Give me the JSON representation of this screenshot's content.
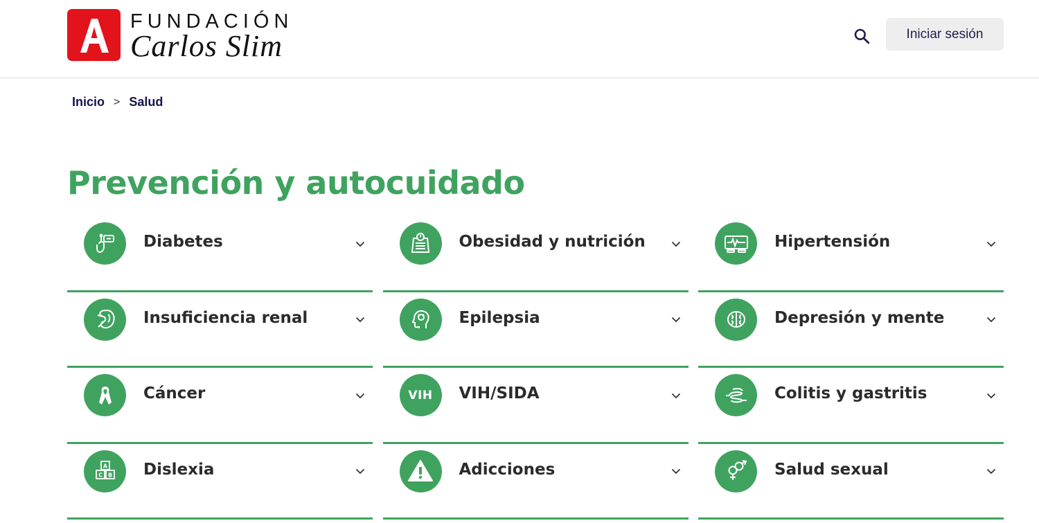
{
  "header": {
    "logo_letter": "A",
    "logo_line1": "FUNDACIÓN",
    "logo_line2": "Carlos Slim",
    "search_icon": "search-icon",
    "login_label": "Iniciar sesión"
  },
  "breadcrumb": {
    "items": [
      "Inicio",
      "Salud"
    ],
    "separator": ">"
  },
  "page": {
    "title": "Prevención y autocuidado"
  },
  "colors": {
    "brand_green": "#3fa35f",
    "logo_red": "#e3131b",
    "nav_text": "#14144a"
  },
  "topics": [
    {
      "label": "Diabetes",
      "icon": "glucometer-icon"
    },
    {
      "label": "Obesidad y nutrición",
      "icon": "scale-icon"
    },
    {
      "label": "Hipertensión",
      "icon": "heart-monitor-icon"
    },
    {
      "label": "Insuficiencia renal",
      "icon": "kidney-icon"
    },
    {
      "label": "Epilepsia",
      "icon": "brain-head-icon"
    },
    {
      "label": "Depresión y mente",
      "icon": "brain-icon"
    },
    {
      "label": "Cáncer",
      "icon": "ribbon-icon"
    },
    {
      "label": "VIH/SIDA",
      "icon": "vih-text-icon",
      "icon_text": "VIH"
    },
    {
      "label": "Colitis y gastritis",
      "icon": "intestine-icon"
    },
    {
      "label": "Dislexia",
      "icon": "abc-blocks-icon"
    },
    {
      "label": "Adicciones",
      "icon": "warning-icon"
    },
    {
      "label": "Salud sexual",
      "icon": "gender-symbols-icon"
    }
  ],
  "icon_letters": {
    "blocks": [
      "A",
      "C",
      "B"
    ]
  }
}
